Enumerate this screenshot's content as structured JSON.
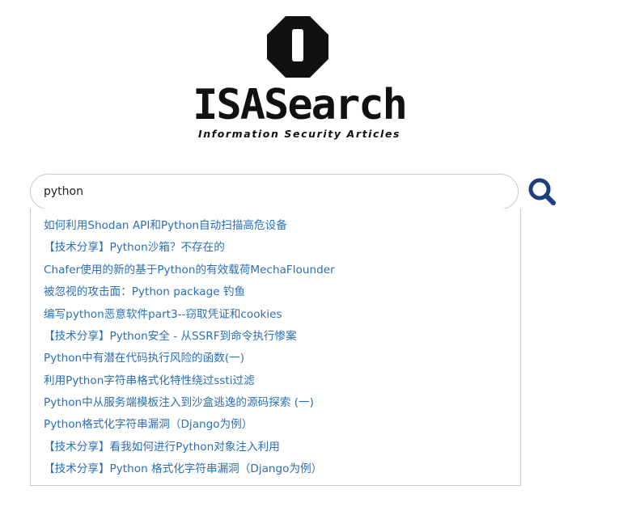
{
  "logo": {
    "mark_letter": "I",
    "title": "ISASearch",
    "tagline": "Information Security Articles"
  },
  "search": {
    "value": "python",
    "button_icon": "search-icon"
  },
  "suggestions": [
    "如何利用Shodan API和Python自动扫描高危设备",
    "【技术分享】Python沙箱？不存在的",
    "Chafer使用的新的基于Python的有效载荷MechaFlounder",
    "被忽视的攻击面：Python package 钓鱼",
    "编写python恶意软件part3--窃取凭证和cookies",
    "【技术分享】Python安全 - 从SSRF到命令执行惨案",
    "Python中有潜在代码执行风险的函数(一)",
    "利用Python字符串格式化特性绕过ssti过滤",
    "Python中从服务端模板注入到沙盒逃逸的源码探索 (一)",
    "Python格式化字符串漏洞（Django为例）",
    "【技术分享】看我如何进行Python对象注入利用",
    "【技术分享】Python 格式化字符串漏洞（Django为例）"
  ],
  "colors": {
    "link": "#2a6fb5",
    "search_icon": "#1d3f80",
    "logo": "#111111"
  }
}
